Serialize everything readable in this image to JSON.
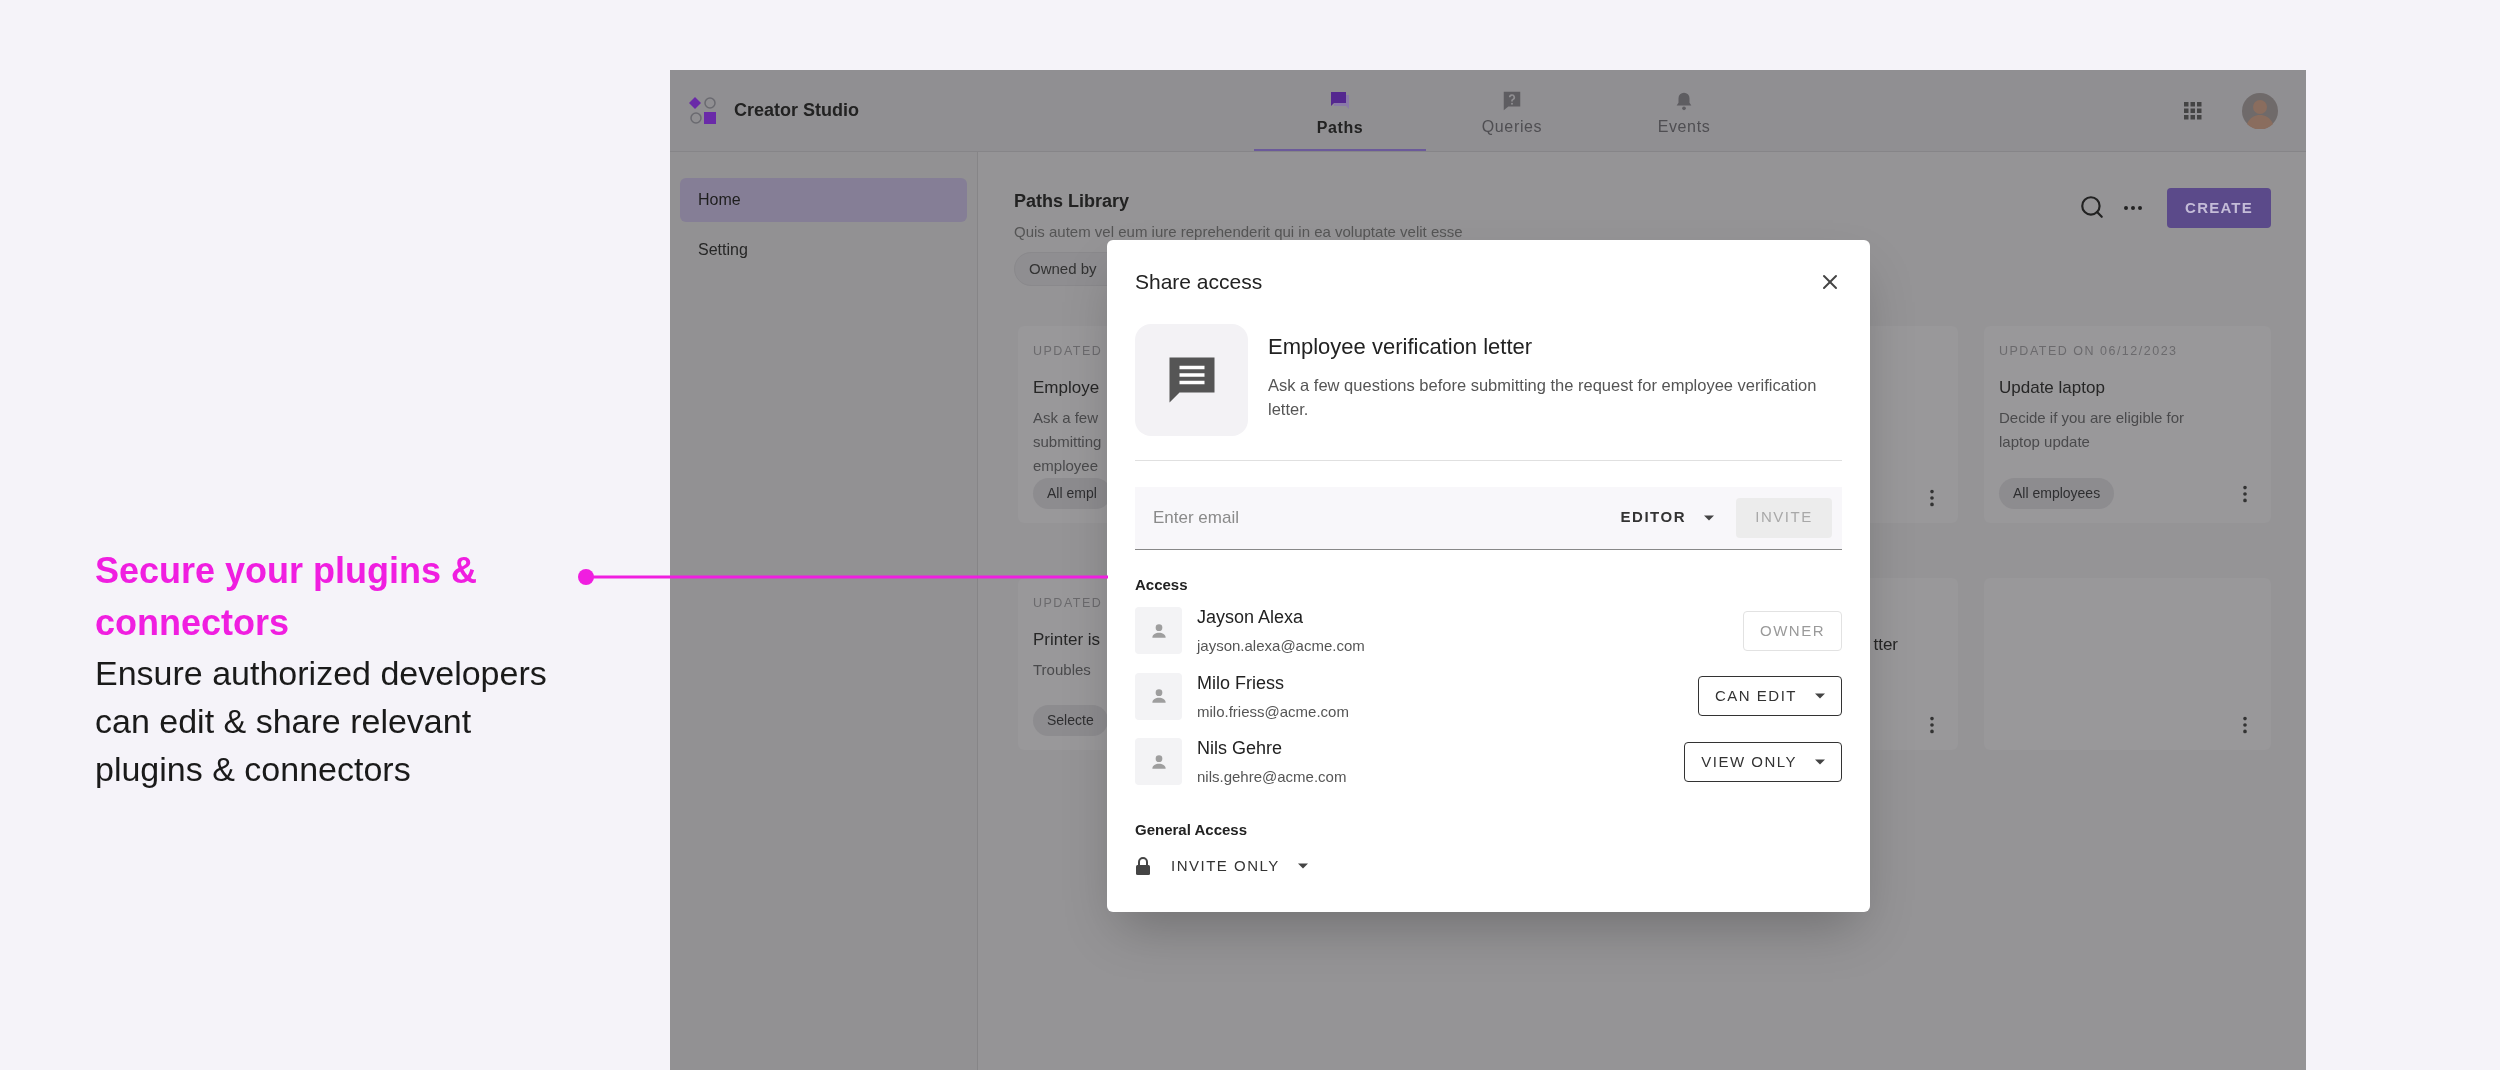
{
  "callout": {
    "title": "Secure your plugins & connectors",
    "body": "Ensure authorized developers can edit & share relevant plugins & connectors"
  },
  "app": {
    "name": "Creator Studio",
    "tabs": [
      {
        "label": "Paths",
        "selected": true,
        "kind": "chat"
      },
      {
        "label": "Queries",
        "selected": false,
        "kind": "help"
      },
      {
        "label": "Events",
        "selected": false,
        "kind": "bell"
      }
    ],
    "sidebar": {
      "items": [
        {
          "label": "Home",
          "selected": true
        },
        {
          "label": "Setting",
          "selected": false
        }
      ]
    },
    "library": {
      "title": "Paths Library",
      "subtitle": "Quis autem vel eum iure reprehenderit qui in ea voluptate velit esse",
      "filter_chip": "Owned by",
      "create_button": "CREATE",
      "card_rows": [
        {
          "cards": [
            {
              "updated": "UPDATED",
              "title": "Employe",
              "description_lines": [
                "Ask a few",
                "submitting",
                "employee"
              ],
              "chip": "All empl"
            },
            {
              "menu": true
            },
            {
              "updated": "UPDATED ON 06/12/2023",
              "title": "Update laptop",
              "description_lines": [
                "Decide if you are eligible for",
                "laptop update"
              ],
              "chip": "All employees",
              "menu": true
            }
          ]
        },
        {
          "cards": [
            {
              "updated": "UPDATED",
              "title": "Printer is",
              "description_lines": [
                "Troubles"
              ],
              "chip": "Selecte"
            },
            {
              "title": "tter",
              "menu": true
            },
            {
              "menu": true
            }
          ]
        }
      ]
    }
  },
  "dialog": {
    "title": "Share access",
    "item": {
      "title": "Employee verification letter",
      "description": "Ask a few questions before submitting the request for employee verification letter."
    },
    "email_field": {
      "placeholder": "Enter email"
    },
    "role_menu": "EDITOR",
    "invite_button": {
      "label": "INVITE",
      "disabled": true
    },
    "access_label": "Access",
    "people": [
      {
        "name": "Jayson Alexa",
        "email": "jayson.alexa@acme.com",
        "permission": "OWNER",
        "disabled": true
      },
      {
        "name": "Milo Friess",
        "email": "milo.friess@acme.com",
        "permission": "CAN EDIT",
        "disabled": false
      },
      {
        "name": "Nils Gehre",
        "email": "nils.gehre@acme.com",
        "permission": "VIEW ONLY",
        "disabled": false
      }
    ],
    "general_access_label": "General Access",
    "general_access": "INVITE ONLY"
  }
}
